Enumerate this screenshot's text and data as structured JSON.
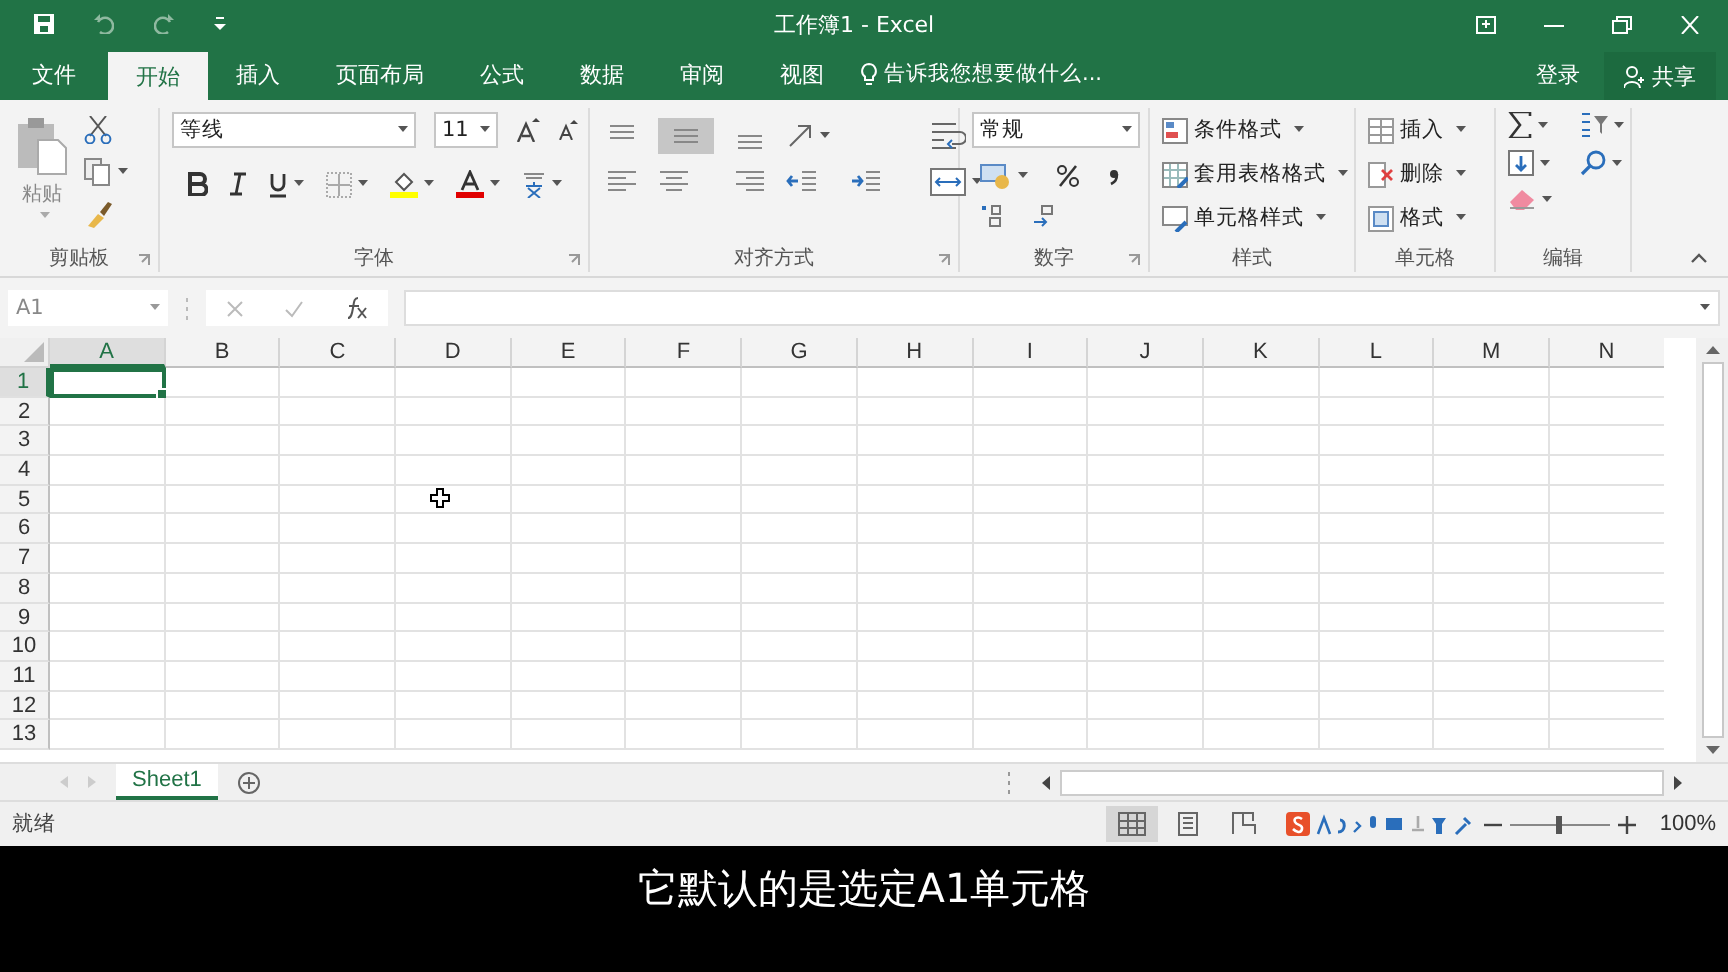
{
  "window": {
    "title": "工作簿1 - Excel"
  },
  "tabs": [
    {
      "label": "文件",
      "selected": false
    },
    {
      "label": "开始",
      "selected": true
    },
    {
      "label": "插入",
      "selected": false
    },
    {
      "label": "页面布局",
      "selected": false
    },
    {
      "label": "公式",
      "selected": false
    },
    {
      "label": "数据",
      "selected": false
    },
    {
      "label": "审阅",
      "selected": false
    },
    {
      "label": "视图",
      "selected": false
    }
  ],
  "tell_me": {
    "placeholder": "告诉我您想要做什么..."
  },
  "sign_in": "登录",
  "share": "共享",
  "ribbon": {
    "clipboard": {
      "paste": "粘贴",
      "label": "剪贴板"
    },
    "font": {
      "font_name": "等线",
      "font_size": "11",
      "label": "字体"
    },
    "alignment": {
      "label": "对齐方式"
    },
    "number": {
      "format": "常规",
      "label": "数字"
    },
    "styles": {
      "items": [
        "条件格式",
        "套用表格格式",
        "单元格样式"
      ],
      "label": "样式"
    },
    "cells": {
      "items": [
        "插入",
        "删除",
        "格式"
      ],
      "label": "单元格"
    },
    "editing": {
      "label": "编辑"
    }
  },
  "name_box": "A1",
  "columns": [
    {
      "label": "A",
      "selected": true
    },
    {
      "label": "B",
      "selected": false
    },
    {
      "label": "C",
      "selected": false
    },
    {
      "label": "D",
      "selected": false
    },
    {
      "label": "E",
      "selected": false
    },
    {
      "label": "F",
      "selected": false
    },
    {
      "label": "G",
      "selected": false
    },
    {
      "label": "H",
      "selected": false
    },
    {
      "label": "I",
      "selected": false
    },
    {
      "label": "J",
      "selected": false
    },
    {
      "label": "K",
      "selected": false
    },
    {
      "label": "L",
      "selected": false
    },
    {
      "label": "M",
      "selected": false
    },
    {
      "label": "N",
      "selected": false
    }
  ],
  "rows": [
    {
      "label": "1",
      "selected": true
    },
    {
      "label": "2",
      "selected": false
    },
    {
      "label": "3",
      "selected": false
    },
    {
      "label": "4",
      "selected": false
    },
    {
      "label": "5",
      "selected": false
    },
    {
      "label": "6",
      "selected": false
    },
    {
      "label": "7",
      "selected": false
    },
    {
      "label": "8",
      "selected": false
    },
    {
      "label": "9",
      "selected": false
    },
    {
      "label": "10",
      "selected": false
    },
    {
      "label": "11",
      "selected": false
    },
    {
      "label": "12",
      "selected": false
    },
    {
      "label": "13",
      "selected": false
    }
  ],
  "sheets": [
    {
      "name": "Sheet1",
      "selected": true
    }
  ],
  "status_bar": {
    "status": "就绪",
    "zoom_slider": {
      "level": 0.5
    },
    "zoom": "100%"
  },
  "subtitle": "它默认的是选定A1单元格"
}
